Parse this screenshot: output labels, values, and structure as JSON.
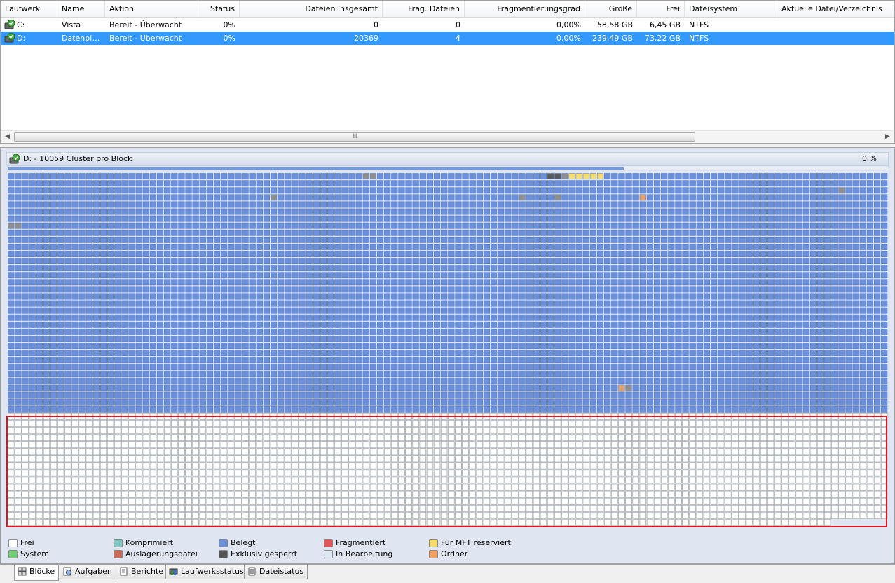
{
  "list": {
    "columns": [
      {
        "label": "Laufwerk"
      },
      {
        "label": "Name"
      },
      {
        "label": "Aktion"
      },
      {
        "label": "Status"
      },
      {
        "label": "Dateien insgesamt"
      },
      {
        "label": "Frag. Dateien"
      },
      {
        "label": "Fragmentierungsgrad"
      },
      {
        "label": "Größe"
      },
      {
        "label": "Frei"
      },
      {
        "label": "Dateisystem"
      },
      {
        "label": "Aktuelle Datei/Verzeichnis"
      }
    ],
    "rows": [
      {
        "drive": "C:",
        "name": "Vista",
        "action": "Bereit - Überwacht",
        "status": "0%",
        "files_total": "0",
        "frag_files": "0",
        "frag_degree": "0,00%",
        "size": "58,58 GB",
        "free": "6,45 GB",
        "filesystem": "NTFS",
        "current": "",
        "selected": false
      },
      {
        "drive": "D:",
        "name": "Datenpla...",
        "action": "Bereit - Überwacht",
        "status": "0%",
        "files_total": "20369",
        "frag_files": "4",
        "frag_degree": "0,00%",
        "size": "239,49 GB",
        "free": "73,22 GB",
        "filesystem": "NTFS",
        "current": "",
        "selected": true
      }
    ],
    "scrollbar_grip": "III"
  },
  "map": {
    "title": "D: - 10059 Cluster pro Block",
    "percent": "0 %",
    "progress": 0.7,
    "colors": {
      "used": "#6b8fd9",
      "free": "#ffffff",
      "system": "#8e8e8e",
      "locked": "#5a5a5a",
      "mft": "#f5dc6a",
      "folder": "#e6a16a",
      "highlight": "#e0141e"
    },
    "grid": {
      "columns": 124,
      "rows": 50,
      "used_rows": 34
    }
  },
  "legend": [
    {
      "label": "Frei",
      "color": "#ffffff"
    },
    {
      "label": "System",
      "color": "#6fcf72"
    },
    {
      "label": "Komprimiert",
      "color": "#7fc8c4"
    },
    {
      "label": "Auslagerungsdatei",
      "color": "#c96a5a"
    },
    {
      "label": "Belegt",
      "color": "#6b8fd9"
    },
    {
      "label": "Exklusiv gesperrt",
      "color": "#555555"
    },
    {
      "label": "Fragmentiert",
      "color": "#e05656"
    },
    {
      "label": "In Bearbeitung",
      "color": "#dde8f3"
    },
    {
      "label": "Für MFT reserviert",
      "color": "#f5dc6a"
    },
    {
      "label": "Ordner",
      "color": "#f0a060"
    }
  ],
  "tabs": [
    {
      "label": "Blöcke",
      "icon": "blocks-icon",
      "active": true
    },
    {
      "label": "Aufgaben",
      "icon": "tasks-icon",
      "active": false
    },
    {
      "label": "Berichte",
      "icon": "reports-icon",
      "active": false
    },
    {
      "label": "Laufwerksstatus",
      "icon": "drive-status-icon",
      "active": false
    },
    {
      "label": "Dateistatus",
      "icon": "file-status-icon",
      "active": false
    }
  ]
}
